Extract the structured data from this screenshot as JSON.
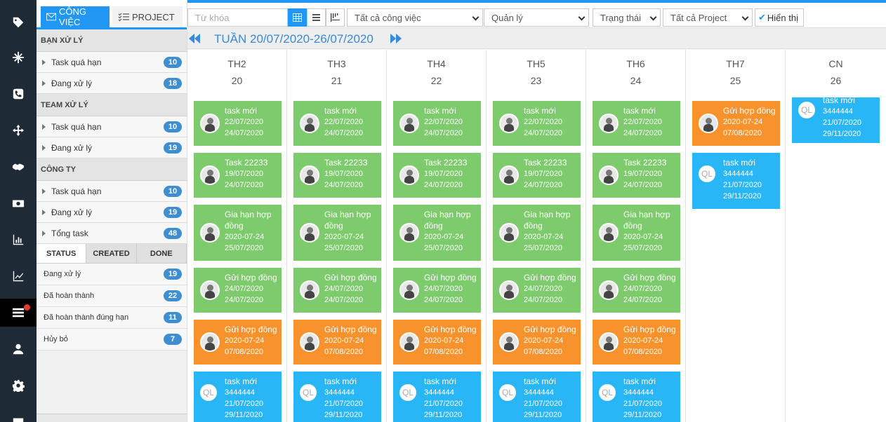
{
  "sidebar": {
    "tabs": {
      "congviec": "CÔNG VIỆC",
      "project": "PROJECT"
    },
    "sections": [
      {
        "title": "BẠN XỬ LÝ",
        "rows": [
          {
            "label": "Task quá hạn",
            "count": "10"
          },
          {
            "label": "Đang xử lý",
            "count": "18"
          }
        ]
      },
      {
        "title": "TEAM XỬ LÝ",
        "rows": [
          {
            "label": "Task quá hạn",
            "count": "10"
          },
          {
            "label": "Đang xử lý",
            "count": "19"
          }
        ]
      },
      {
        "title": "CÔNG TY",
        "rows": [
          {
            "label": "Task quá hạn",
            "count": "10"
          },
          {
            "label": "Đang xử lý",
            "count": "19"
          },
          {
            "label": "Tổng task",
            "count": "48"
          }
        ]
      }
    ],
    "status_tabs": [
      "STATUS",
      "CREATED",
      "DONE"
    ],
    "status_rows": [
      {
        "label": "Đang xử lý",
        "count": "19"
      },
      {
        "label": "Đã hoàn thành",
        "count": "22"
      },
      {
        "label": "Đã hoàn thành đúng hạn",
        "count": "11"
      },
      {
        "label": "Hủy bỏ",
        "count": "7"
      }
    ]
  },
  "toolbar": {
    "search_placeholder": "Từ khóa",
    "filter_all_work": "Tất cả công việc",
    "filter_manager": "Quản lý",
    "filter_status": "Trạng thái",
    "filter_project": "Tất cả Project",
    "show_button": "Hiển thị"
  },
  "week": {
    "title": "TUẦN 20/07/2020-26/07/2020"
  },
  "days": [
    {
      "name": "TH2",
      "date": "20"
    },
    {
      "name": "TH3",
      "date": "21"
    },
    {
      "name": "TH4",
      "date": "22"
    },
    {
      "name": "TH5",
      "date": "23"
    },
    {
      "name": "TH6",
      "date": "24"
    },
    {
      "name": "TH7",
      "date": "25"
    },
    {
      "name": "CN",
      "date": "26"
    }
  ],
  "tasks": {
    "task_moi": {
      "line1": "task mới",
      "line2": "22/07/2020",
      "line3": "24/07/2020"
    },
    "task_22233": {
      "line1": "Task 22233",
      "line2": "19/07/2020",
      "line3": "24/07/2020"
    },
    "gia_han": {
      "line1": "Gia hạn hợp",
      "line1b": "đồng",
      "line2": "2020-07-24",
      "line3": "25/07/2020"
    },
    "gui_hd_1": {
      "line1": "Gửi hợp đồng",
      "line2": "24/07/2020",
      "line3": "24/07/2020"
    },
    "gui_hd_2": {
      "line1": "Gửi hợp đồng",
      "line2": "2020-07-24",
      "line3": "07/08/2020"
    },
    "task_moi_ql": {
      "line1": "task mới",
      "line2": "3444444",
      "line3": "21/07/2020",
      "line4": "29/11/2020",
      "avatar": "QL"
    }
  },
  "colors": {
    "green": "#7dcb6c",
    "orange": "#f8922d",
    "blue": "#29b6f6",
    "accent": "#2196f3"
  }
}
